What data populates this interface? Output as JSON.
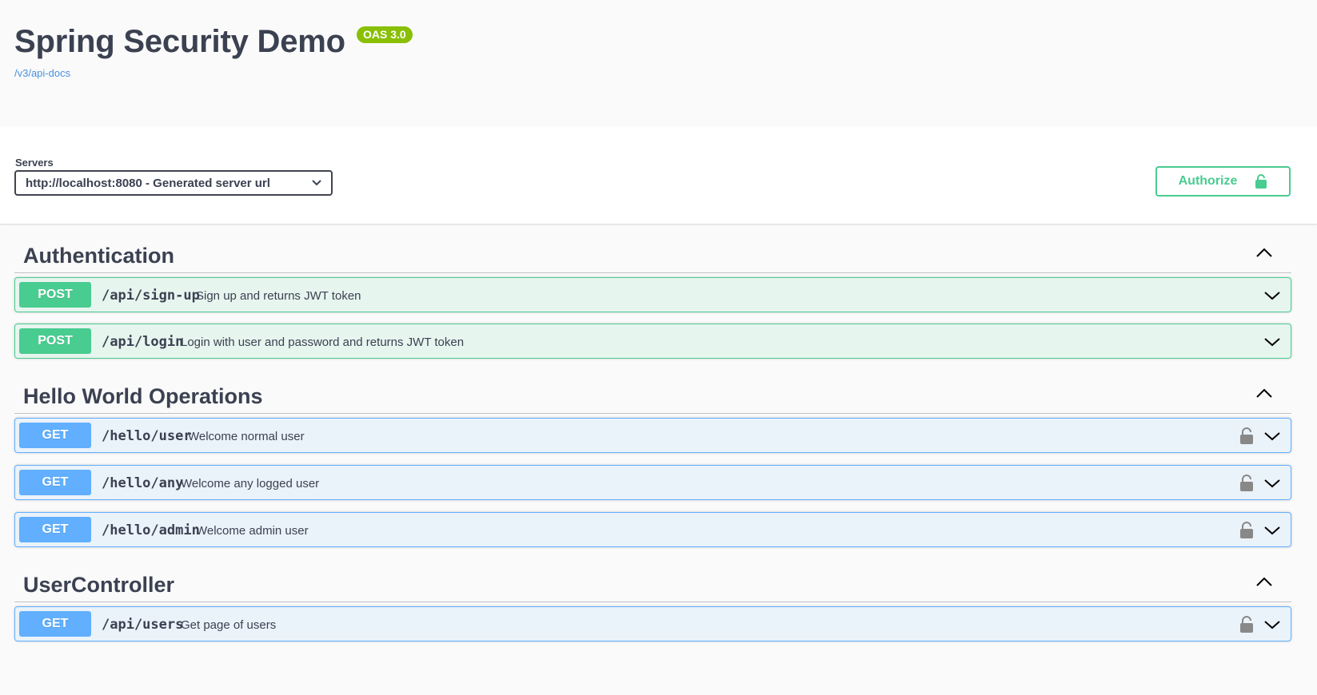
{
  "info": {
    "title": "Spring Security Demo",
    "version_badge": "OAS 3.0",
    "docs_link": "/v3/api-docs"
  },
  "scheme": {
    "servers_label": "Servers",
    "server_selected": "http://localhost:8080 - Generated server url",
    "authorize_label": "Authorize"
  },
  "tags": [
    {
      "name": "Authentication",
      "operations": [
        {
          "method": "POST",
          "path": "/api/sign-up",
          "summary": "Sign up and returns JWT token",
          "locked": false
        },
        {
          "method": "POST",
          "path": "/api/login",
          "summary": "Login with user and password and returns JWT token",
          "locked": false
        }
      ]
    },
    {
      "name": "Hello World Operations",
      "operations": [
        {
          "method": "GET",
          "path": "/hello/user",
          "summary": "Welcome normal user",
          "locked": true
        },
        {
          "method": "GET",
          "path": "/hello/any",
          "summary": "Welcome any logged user",
          "locked": true
        },
        {
          "method": "GET",
          "path": "/hello/admin",
          "summary": "Welcome admin user",
          "locked": true
        }
      ]
    },
    {
      "name": "UserController",
      "operations": [
        {
          "method": "GET",
          "path": "/api/users",
          "summary": "Get page of users",
          "locked": true
        }
      ]
    }
  ],
  "colors": {
    "post": "#49cc90",
    "get": "#61affe",
    "badge": "#89bf04",
    "text": "#3b4151",
    "link": "#4990e2"
  },
  "icons": [
    "lock-icon",
    "chevron-down-icon",
    "chevron-up-icon",
    "unlock-icon"
  ]
}
